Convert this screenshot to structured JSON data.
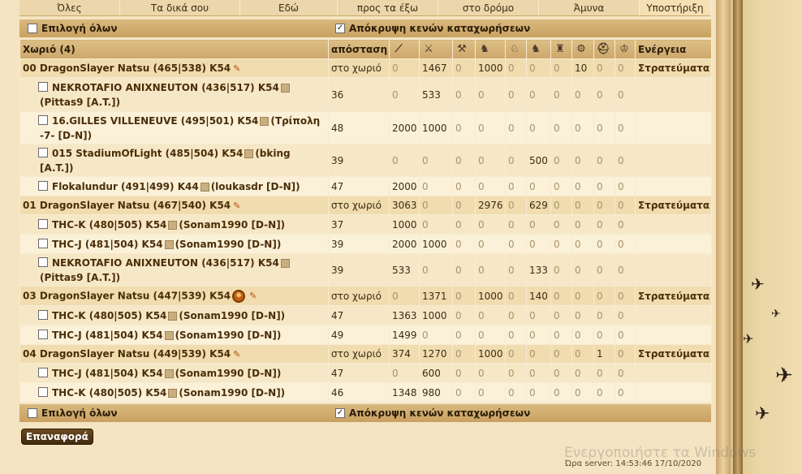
{
  "tabs": [
    "Όλες",
    "Τα δικά σου",
    "Εδώ",
    "προς τα έξω",
    "στο δρόμο",
    "Άμυνα",
    "Υποστήριξη"
  ],
  "options": {
    "select_all": "Επιλογή όλων",
    "hide_empty": "Απόκρυψη κενών καταχωρήσεων"
  },
  "header": {
    "village": "Χωριό (4)",
    "distance": "απόσταση",
    "action": "Ενέργεια"
  },
  "unit_icons": [
    "spear-icon",
    "sword-icon",
    "axe-icon",
    "archer-icon",
    "spy-icon",
    "light-cavalry-icon",
    "mounted-archer-icon",
    "heavy-cavalry-icon",
    "ram-icon",
    "catapult-icon",
    "knight-icon",
    "noble-icon"
  ],
  "rows": [
    {
      "type": "vil",
      "name": "00 DragonSlayer Natsu (465|538) K54",
      "dist": "στο χωριό",
      "vals": [
        "0",
        "1467",
        "0",
        "1000",
        "0",
        "0",
        "0",
        "10",
        "0",
        "0"
      ],
      "action": "Στρατεύματα"
    },
    {
      "type": "sup",
      "name": "NEKROTAFIO ANIXNEUTON (436|517) K54",
      "owner": "(Pittas9 [A.T.])",
      "dist": "36",
      "vals": [
        "0",
        "533",
        "0",
        "0",
        "0",
        "0",
        "0",
        "0",
        "0",
        "0"
      ]
    },
    {
      "type": "sup",
      "name": "16.GILLES VILLENEUVE (495|501) K54",
      "owner": "(Τρίπολη -7- [D-N])",
      "dist": "48",
      "vals": [
        "2000",
        "1000",
        "0",
        "0",
        "0",
        "0",
        "0",
        "0",
        "0",
        "0"
      ]
    },
    {
      "type": "sup",
      "name": "015 StadiumOfLight (485|504) K54",
      "owner": "(bking [A.T.])",
      "dist": "39",
      "vals": [
        "0",
        "0",
        "0",
        "0",
        "0",
        "500",
        "0",
        "0",
        "0",
        "0"
      ]
    },
    {
      "type": "sup",
      "name": "Flokalundur (491|499) K44",
      "owner": "(loukasdr [D-N])",
      "dist": "47",
      "vals": [
        "2000",
        "0",
        "0",
        "0",
        "0",
        "0",
        "0",
        "0",
        "0",
        "0"
      ]
    },
    {
      "type": "vil",
      "name": "01 DragonSlayer Natsu (467|540) K54",
      "dist": "στο χωριό",
      "vals": [
        "3063",
        "0",
        "0",
        "2976",
        "0",
        "629",
        "0",
        "0",
        "0",
        "0"
      ],
      "action": "Στρατεύματα"
    },
    {
      "type": "sup",
      "name": "THC-K (480|505) K54",
      "owner": "(Sonam1990 [D-N])",
      "dist": "37",
      "vals": [
        "1000",
        "0",
        "0",
        "0",
        "0",
        "0",
        "0",
        "0",
        "0",
        "0"
      ]
    },
    {
      "type": "sup",
      "name": "THC-J (481|504) K54",
      "owner": "(Sonam1990 [D-N])",
      "dist": "39",
      "vals": [
        "2000",
        "1000",
        "0",
        "0",
        "0",
        "0",
        "0",
        "0",
        "0",
        "0"
      ]
    },
    {
      "type": "sup",
      "name": "NEKROTAFIO ANIXNEUTON (436|517) K54",
      "owner": "(Pittas9 [A.T.])",
      "dist": "39",
      "vals": [
        "533",
        "0",
        "0",
        "0",
        "0",
        "133",
        "0",
        "0",
        "0",
        "0"
      ]
    },
    {
      "type": "vil",
      "name": "03 DragonSlayer Natsu (447|539) K54",
      "dist": "στο χωριό",
      "vals": [
        "0",
        "1371",
        "0",
        "1000",
        "0",
        "140",
        "0",
        "0",
        "0",
        "0"
      ],
      "action": "Στρατεύματα",
      "wheel": true
    },
    {
      "type": "sup",
      "name": "THC-K (480|505) K54",
      "owner": "(Sonam1990 [D-N])",
      "dist": "47",
      "vals": [
        "1363",
        "1000",
        "0",
        "0",
        "0",
        "0",
        "0",
        "0",
        "0",
        "0"
      ]
    },
    {
      "type": "sup",
      "name": "THC-J (481|504) K54",
      "owner": "(Sonam1990 [D-N])",
      "dist": "49",
      "vals": [
        "1499",
        "0",
        "0",
        "0",
        "0",
        "0",
        "0",
        "0",
        "0",
        "0"
      ]
    },
    {
      "type": "vil",
      "name": "04 DragonSlayer Natsu (449|539) K54",
      "dist": "στο χωριό",
      "vals": [
        "374",
        "1270",
        "0",
        "1000",
        "0",
        "0",
        "0",
        "0",
        "1",
        "0"
      ],
      "action": "Στρατεύματα"
    },
    {
      "type": "sup",
      "name": "THC-J (481|504) K54",
      "owner": "(Sonam1990 [D-N])",
      "dist": "47",
      "vals": [
        "0",
        "600",
        "0",
        "0",
        "0",
        "0",
        "0",
        "0",
        "0",
        "0"
      ]
    },
    {
      "type": "sup",
      "name": "THC-K (480|505) K54",
      "owner": "(Sonam1990 [D-N])",
      "dist": "46",
      "vals": [
        "1348",
        "980",
        "0",
        "0",
        "0",
        "0",
        "0",
        "0",
        "0",
        "0"
      ]
    }
  ],
  "reset_label": "Επαναφορά",
  "watermark": "Ενεργοποιήστε τα Windows",
  "server_time": "Ώρα server: 14:53:46 17/10/2020"
}
